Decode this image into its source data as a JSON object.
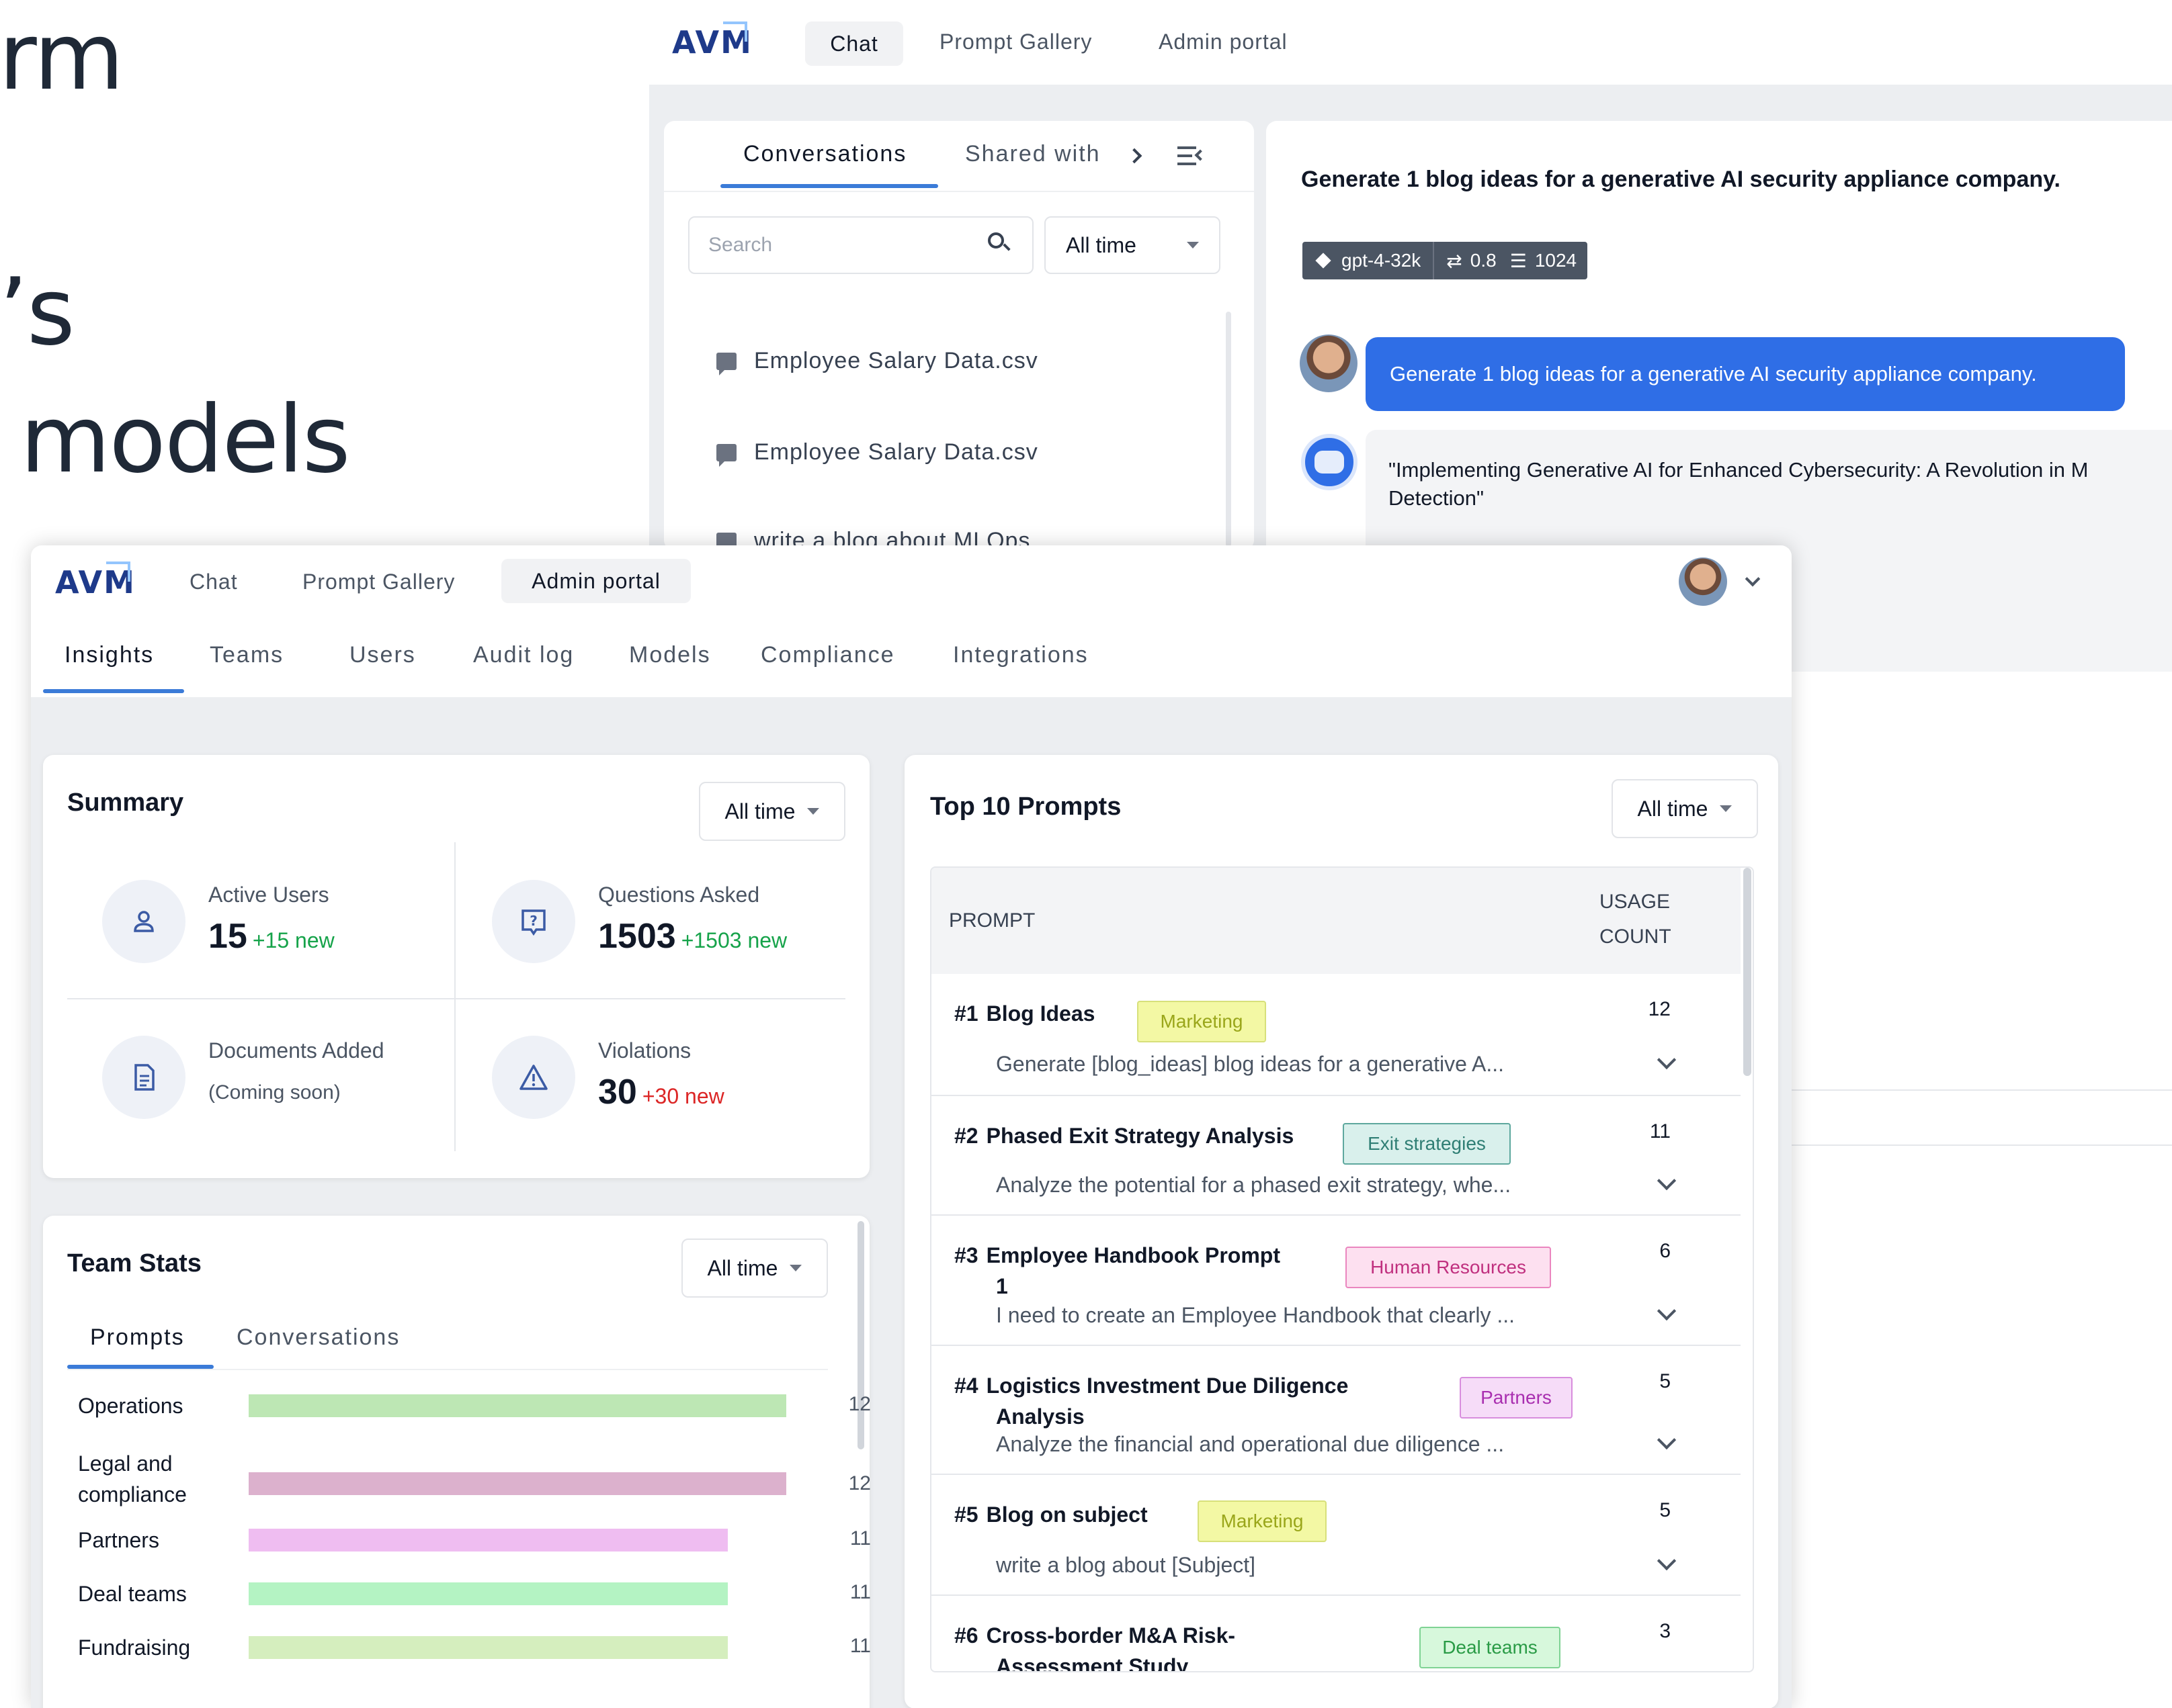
{
  "background_text": {
    "line1": "rm",
    "line2": "’s",
    "line3": "models"
  },
  "back_window": {
    "logo": "AVM",
    "nav": {
      "chat": "Chat",
      "prompt_gallery": "Prompt Gallery",
      "admin_portal": "Admin portal"
    },
    "sidebar": {
      "tab_conversations": "Conversations",
      "tab_shared": "Shared with",
      "search_placeholder": "Search",
      "filter": "All time",
      "items": [
        {
          "label": "Employee Salary Data.csv"
        },
        {
          "label": "Employee Salary Data.csv"
        },
        {
          "label": "write a blog about MLOps"
        }
      ]
    },
    "chat": {
      "title": "Generate 1 blog ideas for a generative AI security appliance company.",
      "model": "gpt-4-32k",
      "temperature": "0.8",
      "max_tokens": "1024",
      "user_message": "Generate 1 blog ideas for a generative AI security appliance company.",
      "bot_message": "\"Implementing Generative AI for Enhanced Cybersecurity: A Revolution in M",
      "bot_message_line2": "Detection\""
    }
  },
  "front_window": {
    "logo": "AVM",
    "nav": {
      "chat": "Chat",
      "prompt_gallery": "Prompt Gallery",
      "admin_portal": "Admin portal"
    },
    "subnav": {
      "insights": "Insights",
      "teams": "Teams",
      "users": "Users",
      "audit_log": "Audit log",
      "models": "Models",
      "compliance": "Compliance",
      "integrations": "Integrations"
    },
    "summary": {
      "title": "Summary",
      "filter": "All time",
      "active_users": {
        "label": "Active Users",
        "value": "15",
        "new": "+15 new"
      },
      "questions": {
        "label": "Questions Asked",
        "value": "1503",
        "new": "+1503 new"
      },
      "documents": {
        "label": "Documents Added",
        "note": "(Coming soon)"
      },
      "violations": {
        "label": "Violations",
        "value": "30",
        "new": "+30 new"
      }
    },
    "team_stats": {
      "title": "Team Stats",
      "filter": "All time",
      "tab_prompts": "Prompts",
      "tab_conversations": "Conversations",
      "rows": [
        {
          "label": "Operations",
          "value": 12,
          "color": "#bde7b4"
        },
        {
          "label": "Legal and compliance",
          "value": 12,
          "color": "#dcb1cd"
        },
        {
          "label": "Partners",
          "value": 11,
          "color": "#efbdf1"
        },
        {
          "label": "Deal teams",
          "value": 11,
          "color": "#b4f3c3"
        },
        {
          "label": "Fundraising",
          "value": 11,
          "color": "#d5eebe"
        }
      ]
    },
    "top_prompts": {
      "title": "Top 10 Prompts",
      "filter": "All time",
      "col_prompt": "PROMPT",
      "col_usage_1": "USAGE",
      "col_usage_2": "COUNT",
      "rows": [
        {
          "rank": "#1",
          "title": "Blog Ideas",
          "tag": "Marketing",
          "tag_bg": "#f3f8a4",
          "tag_fg": "#9aa61a",
          "tag_border": "#d7e07a",
          "count": "12",
          "desc": "Generate [blog_ideas] blog ideas for a generative A..."
        },
        {
          "rank": "#2",
          "title": "Phased Exit Strategy Analysis",
          "tag": "Exit strategies",
          "tag_bg": "#d9f0ec",
          "tag_fg": "#2f7e74",
          "tag_border": "#5ea89e",
          "count": "11",
          "desc": "Analyze the potential for a phased exit strategy, whe..."
        },
        {
          "rank": "#3",
          "title": "Employee Handbook Prompt",
          "title2": "1",
          "tag": "Human Resources",
          "tag_bg": "#fde0f0",
          "tag_fg": "#c0307f",
          "tag_border": "#ea86bf",
          "count": "6",
          "desc": "I need to create an Employee Handbook that clearly ..."
        },
        {
          "rank": "#4",
          "title": "Logistics Investment Due Diligence",
          "title2": "Analysis",
          "tag": "Partners",
          "tag_bg": "#f6dcf8",
          "tag_fg": "#a92fb0",
          "tag_border": "#d88ddd",
          "count": "5",
          "desc": "Analyze the financial and operational due diligence ..."
        },
        {
          "rank": "#5",
          "title": "Blog on subject",
          "tag": "Marketing",
          "tag_bg": "#f3f8a4",
          "tag_fg": "#9aa61a",
          "tag_border": "#d7e07a",
          "count": "5",
          "desc": "write a blog about [Subject]"
        },
        {
          "rank": "#6",
          "title": "Cross-border M&A Risk-",
          "title2": "Assessment Study",
          "tag": "Deal teams",
          "tag_bg": "#d7f8dc",
          "tag_fg": "#2a9b46",
          "tag_border": "#7fd394",
          "count": "3",
          "desc": ""
        }
      ]
    }
  },
  "colors": {
    "accent": "#2f6ee6",
    "logo": "#1e3a8a",
    "active_tab_underline": "#3b7bd8"
  }
}
